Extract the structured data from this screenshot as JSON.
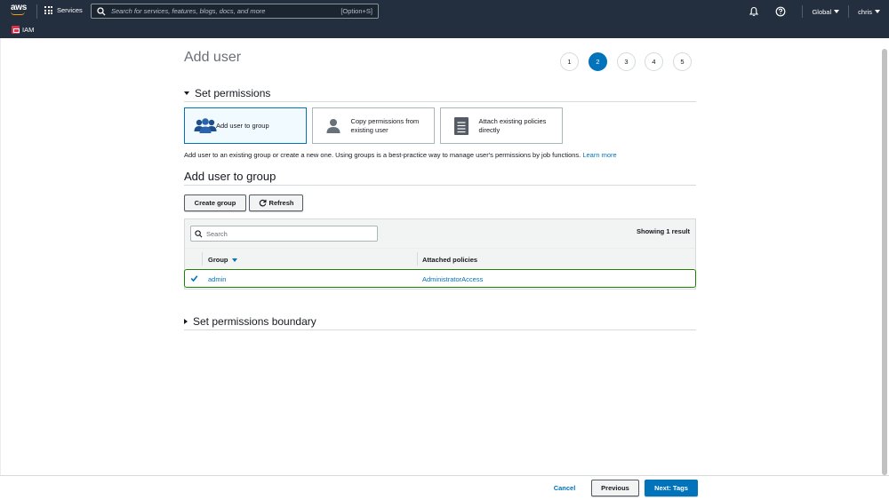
{
  "topbar": {
    "logo_text": "aws",
    "services_label": "Services",
    "search_placeholder": "Search for services, features, blogs, docs, and more",
    "search_shortcut": "[Option+S]",
    "region_label": "Global",
    "user_label": "chris"
  },
  "service": {
    "name": "IAM"
  },
  "page": {
    "title": "Add user"
  },
  "steps": [
    "1",
    "2",
    "3",
    "4",
    "5"
  ],
  "active_step": "2",
  "permissions": {
    "heading": "Set permissions",
    "options": [
      {
        "label": "Add user to group",
        "icon": "users-group-icon",
        "selected": true
      },
      {
        "label": "Copy permissions from existing user",
        "icon": "user-icon",
        "selected": false
      },
      {
        "label": "Attach existing policies directly",
        "icon": "document-icon",
        "selected": false
      }
    ],
    "description": "Add user to an existing group or create a new one. Using groups is a best-practice way to manage user's permissions by job functions.",
    "learn_more": "Learn more"
  },
  "group_section": {
    "heading": "Add user to group",
    "create_button": "Create group",
    "refresh_button": "Refresh",
    "search_placeholder": "Search",
    "showing": "Showing 1 result",
    "columns": {
      "group": "Group",
      "policies": "Attached policies"
    },
    "rows": [
      {
        "group": "admin",
        "policies": "AdministratorAccess",
        "checked": true
      }
    ]
  },
  "boundary": {
    "heading": "Set permissions boundary"
  },
  "footer": {
    "cancel": "Cancel",
    "previous": "Previous",
    "next": "Next: Tags"
  },
  "colors": {
    "nav_bg": "#232f3e",
    "accent": "#0073bb",
    "aws_orange": "#ff9900",
    "selected_row_border": "#1d8102",
    "iam_badge": "#dd344c"
  }
}
